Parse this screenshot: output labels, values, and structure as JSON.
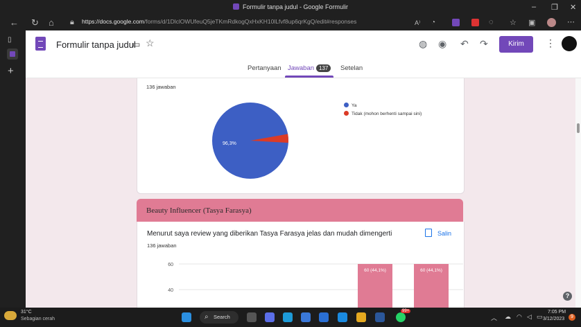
{
  "window": {
    "title": "Formulir tanpa judul - Google Formulir"
  },
  "browser": {
    "url_host": "https://docs.google.com",
    "url_path": "/forms/d/1DlclOWUfeuQ5jeTKmRdkogQxHxKH10lLfvf8up6qrKgQ/edit#responses"
  },
  "app": {
    "form_title": "Formulir tanpa judul",
    "send_label": "Kirim"
  },
  "tabs": [
    {
      "label": "Pertanyaan"
    },
    {
      "label": "Jawaban",
      "badge": "137"
    },
    {
      "label": "Setelan"
    }
  ],
  "q1": {
    "response_count": "136 jawaban",
    "slice_label": "96,3%",
    "legend": [
      "Ya",
      "Tidak (mohon berhenti sampai sini)"
    ],
    "colors": [
      "#3d5fc4",
      "#db3b26"
    ]
  },
  "section": {
    "title": "Beauty Influencer (Tasya Farasya)"
  },
  "q2": {
    "title": "Menurut saya review yang diberikan Tasya Farasya jelas dan mudah dimengerti",
    "copy_label": "Salin",
    "response_count": "136 jawaban"
  },
  "chart_data": [
    {
      "type": "pie",
      "categories": [
        "Ya",
        "Tidak (mohon berhenti sampai sini)"
      ],
      "values": [
        96.3,
        3.7
      ],
      "slice_labels": [
        "96,3%",
        ""
      ]
    },
    {
      "type": "bar",
      "yticks": [
        "60",
        "40"
      ],
      "visible_bars": [
        {
          "value": 60,
          "label": "60 (44,1%)"
        },
        {
          "value": 60,
          "label": "60 (44,1%)"
        }
      ],
      "bar_color": "#e07b94"
    }
  ],
  "taskbar": {
    "temperature": "31°C",
    "weather": "Sebagian cerah",
    "search_label": "Search",
    "whatsapp_badge": "99+",
    "time": "7:05 PM",
    "date": "3/12/2023",
    "notification_count": "9"
  }
}
